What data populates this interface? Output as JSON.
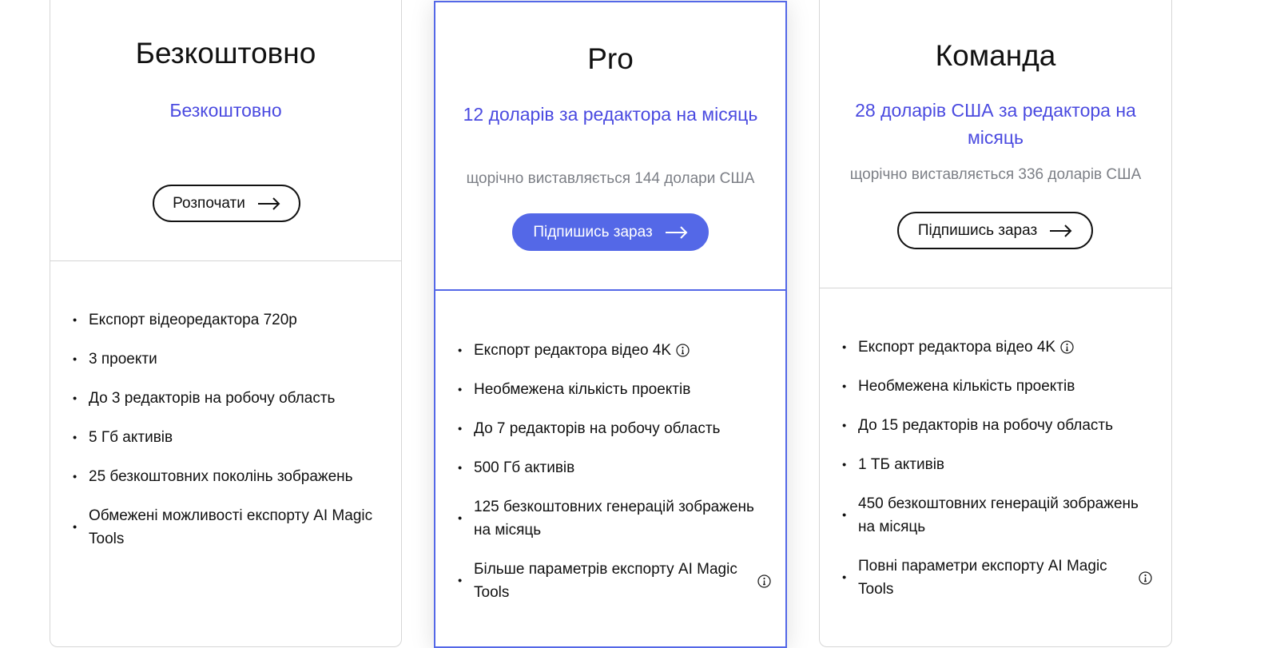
{
  "plans": [
    {
      "name": "Безкоштовно",
      "price": "Безкоштовно",
      "billing": "",
      "button_label": "Розпочати",
      "features": [
        {
          "text": "Експорт відеоредактора 720p",
          "info": false
        },
        {
          "text": "3 проекти",
          "info": false
        },
        {
          "text": "До 3 редакторів на робочу область",
          "info": false
        },
        {
          "text": "5 Гб активів",
          "info": false
        },
        {
          "text": "25 безкоштовних поколінь зображень",
          "info": false
        },
        {
          "text": "Обмежені можливості експорту AI Magic Tools",
          "info": false
        }
      ]
    },
    {
      "name": "Pro",
      "price": "12 доларів за редактора на місяць",
      "billing": "щорічно виставляється 144 долари США",
      "button_label": "Підпишись зараз",
      "features": [
        {
          "text": "Експорт редактора відео 4K",
          "info": true
        },
        {
          "text": "Необмежена кількість проектів",
          "info": false
        },
        {
          "text": "До 7 редакторів на робочу область",
          "info": false
        },
        {
          "text": "500 Гб активів",
          "info": false
        },
        {
          "text": "125 безкоштовних генерацій зображень на місяць",
          "info": false
        },
        {
          "text": "Більше параметрів експорту AI Magic Tools",
          "info": true
        }
      ]
    },
    {
      "name": "Команда",
      "price": "28 доларів США за редактора на місяць",
      "billing": "щорічно виставляється 336 доларів США",
      "button_label": "Підпишись зараз",
      "features": [
        {
          "text": "Експорт редактора відео 4K",
          "info": true
        },
        {
          "text": "Необмежена кількість проектів",
          "info": false
        },
        {
          "text": "До 15 редакторів на робочу область",
          "info": false
        },
        {
          "text": "1 ТБ активів",
          "info": false
        },
        {
          "text": "450 безкоштовних генерацій зображень на місяць",
          "info": false
        },
        {
          "text": "Повні параметри експорту AI Magic Tools",
          "info": true
        }
      ]
    }
  ],
  "icons": {
    "button_arrow": "arrow-right-icon",
    "feature_info": "info-circle-icon"
  },
  "colors": {
    "accent": "#5468e7",
    "price_text": "#4a4ae0",
    "muted_text": "#7c7f86",
    "border": "#d6d6d6"
  }
}
